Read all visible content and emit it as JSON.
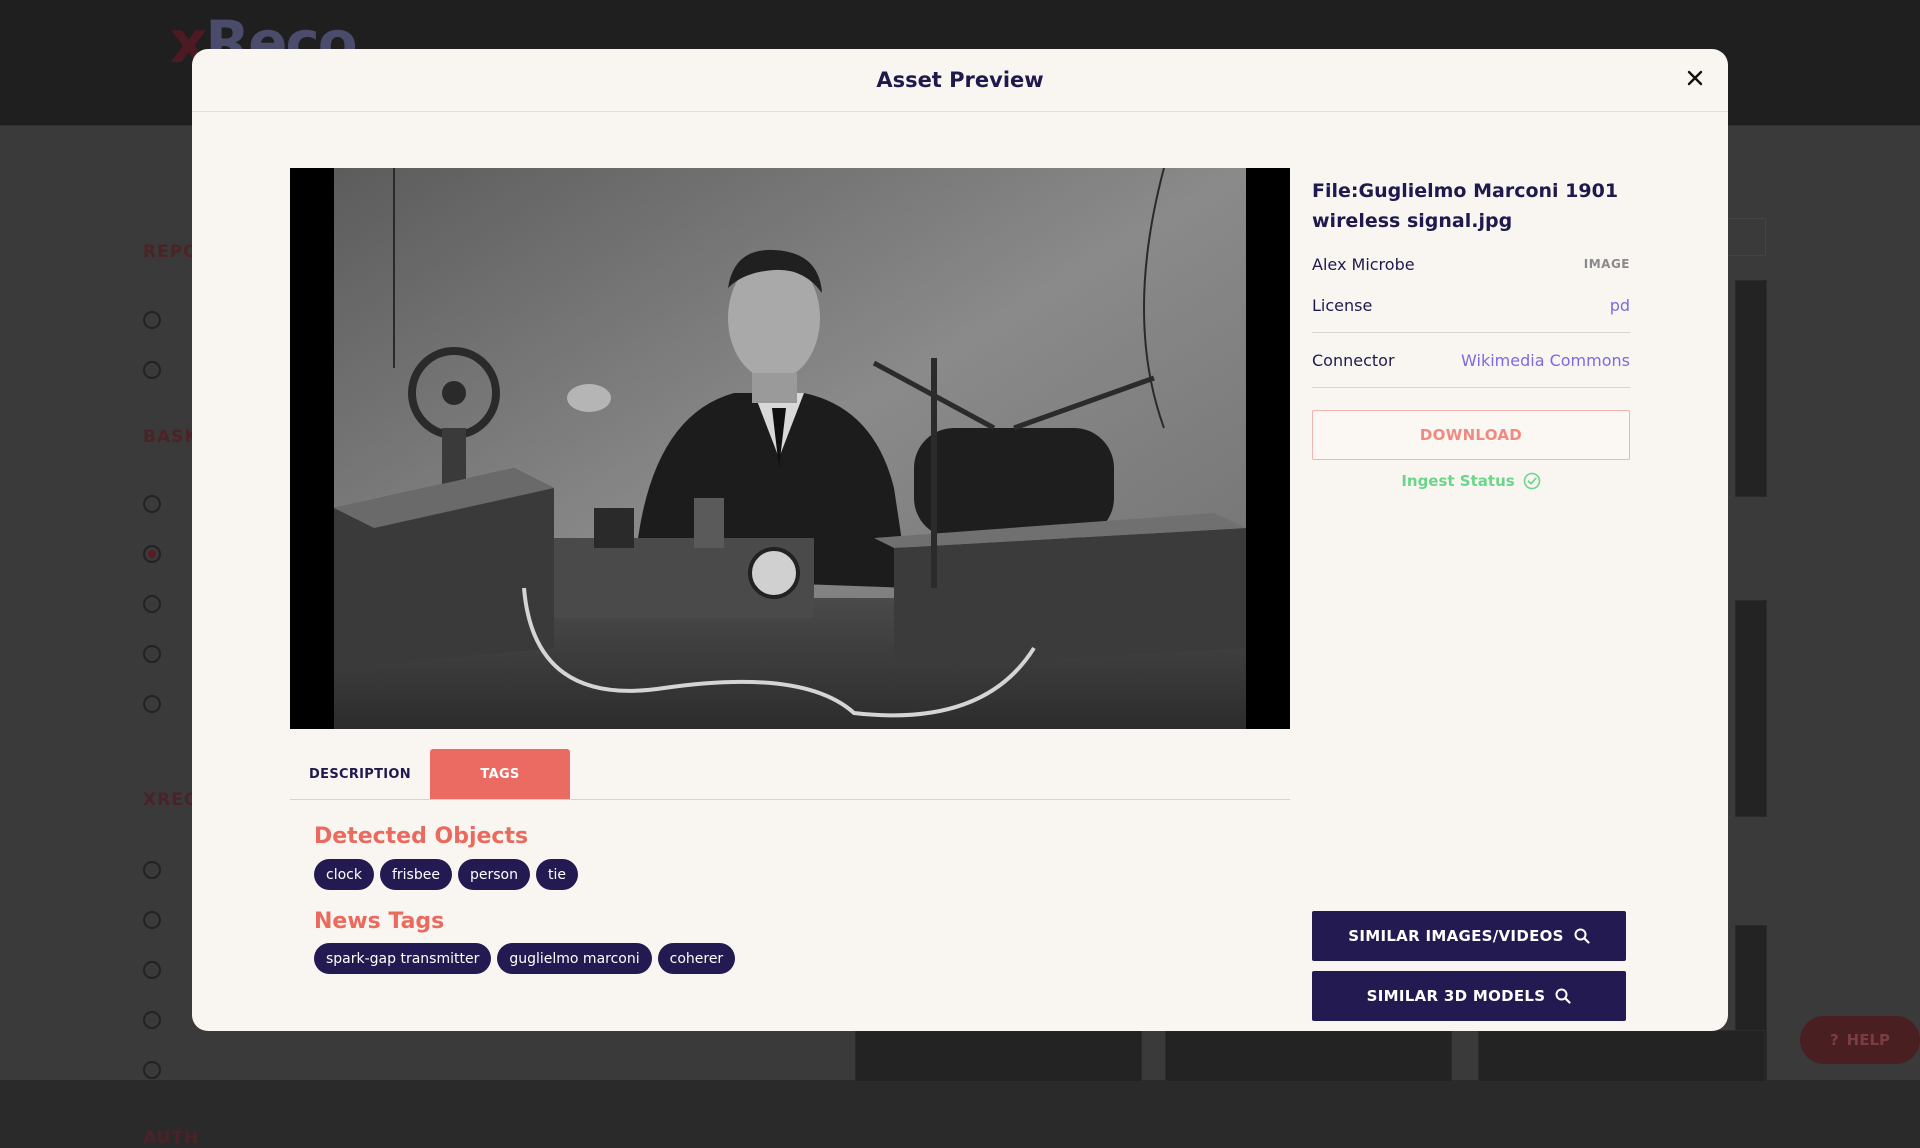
{
  "background": {
    "logo_text": "xReco",
    "help_label": "HELP"
  },
  "modal": {
    "title": "Asset Preview",
    "close_label": "×"
  },
  "asset": {
    "file_title": "File:Guglielmo Marconi 1901 wireless signal.jpg",
    "author": "Alex Microbe",
    "type": "IMAGE",
    "license_label": "License",
    "license_value": "pd",
    "connector_label": "Connector",
    "connector_value": "Wikimedia Commons",
    "download_label": "DOWNLOAD",
    "ingest_label": "Ingest Status"
  },
  "tabs": [
    {
      "label": "DESCRIPTION",
      "active": false
    },
    {
      "label": "TAGS",
      "active": true
    }
  ],
  "detected_objects": {
    "title": "Detected Objects",
    "items": [
      "clock",
      "frisbee",
      "person",
      "tie"
    ]
  },
  "news_tags": {
    "title": "News Tags",
    "items": [
      "spark-gap transmitter",
      "guglielmo marconi",
      "coherer"
    ]
  },
  "actions": {
    "similar_images": "SIMILAR IMAGES/VIDEOS",
    "similar_3d": "SIMILAR 3D MODELS"
  },
  "colors": {
    "accent": "#eb6a62",
    "navy": "#241a52",
    "link": "#7a6be0",
    "success": "#6cd58a",
    "modal_bg": "#f9f6f2"
  }
}
